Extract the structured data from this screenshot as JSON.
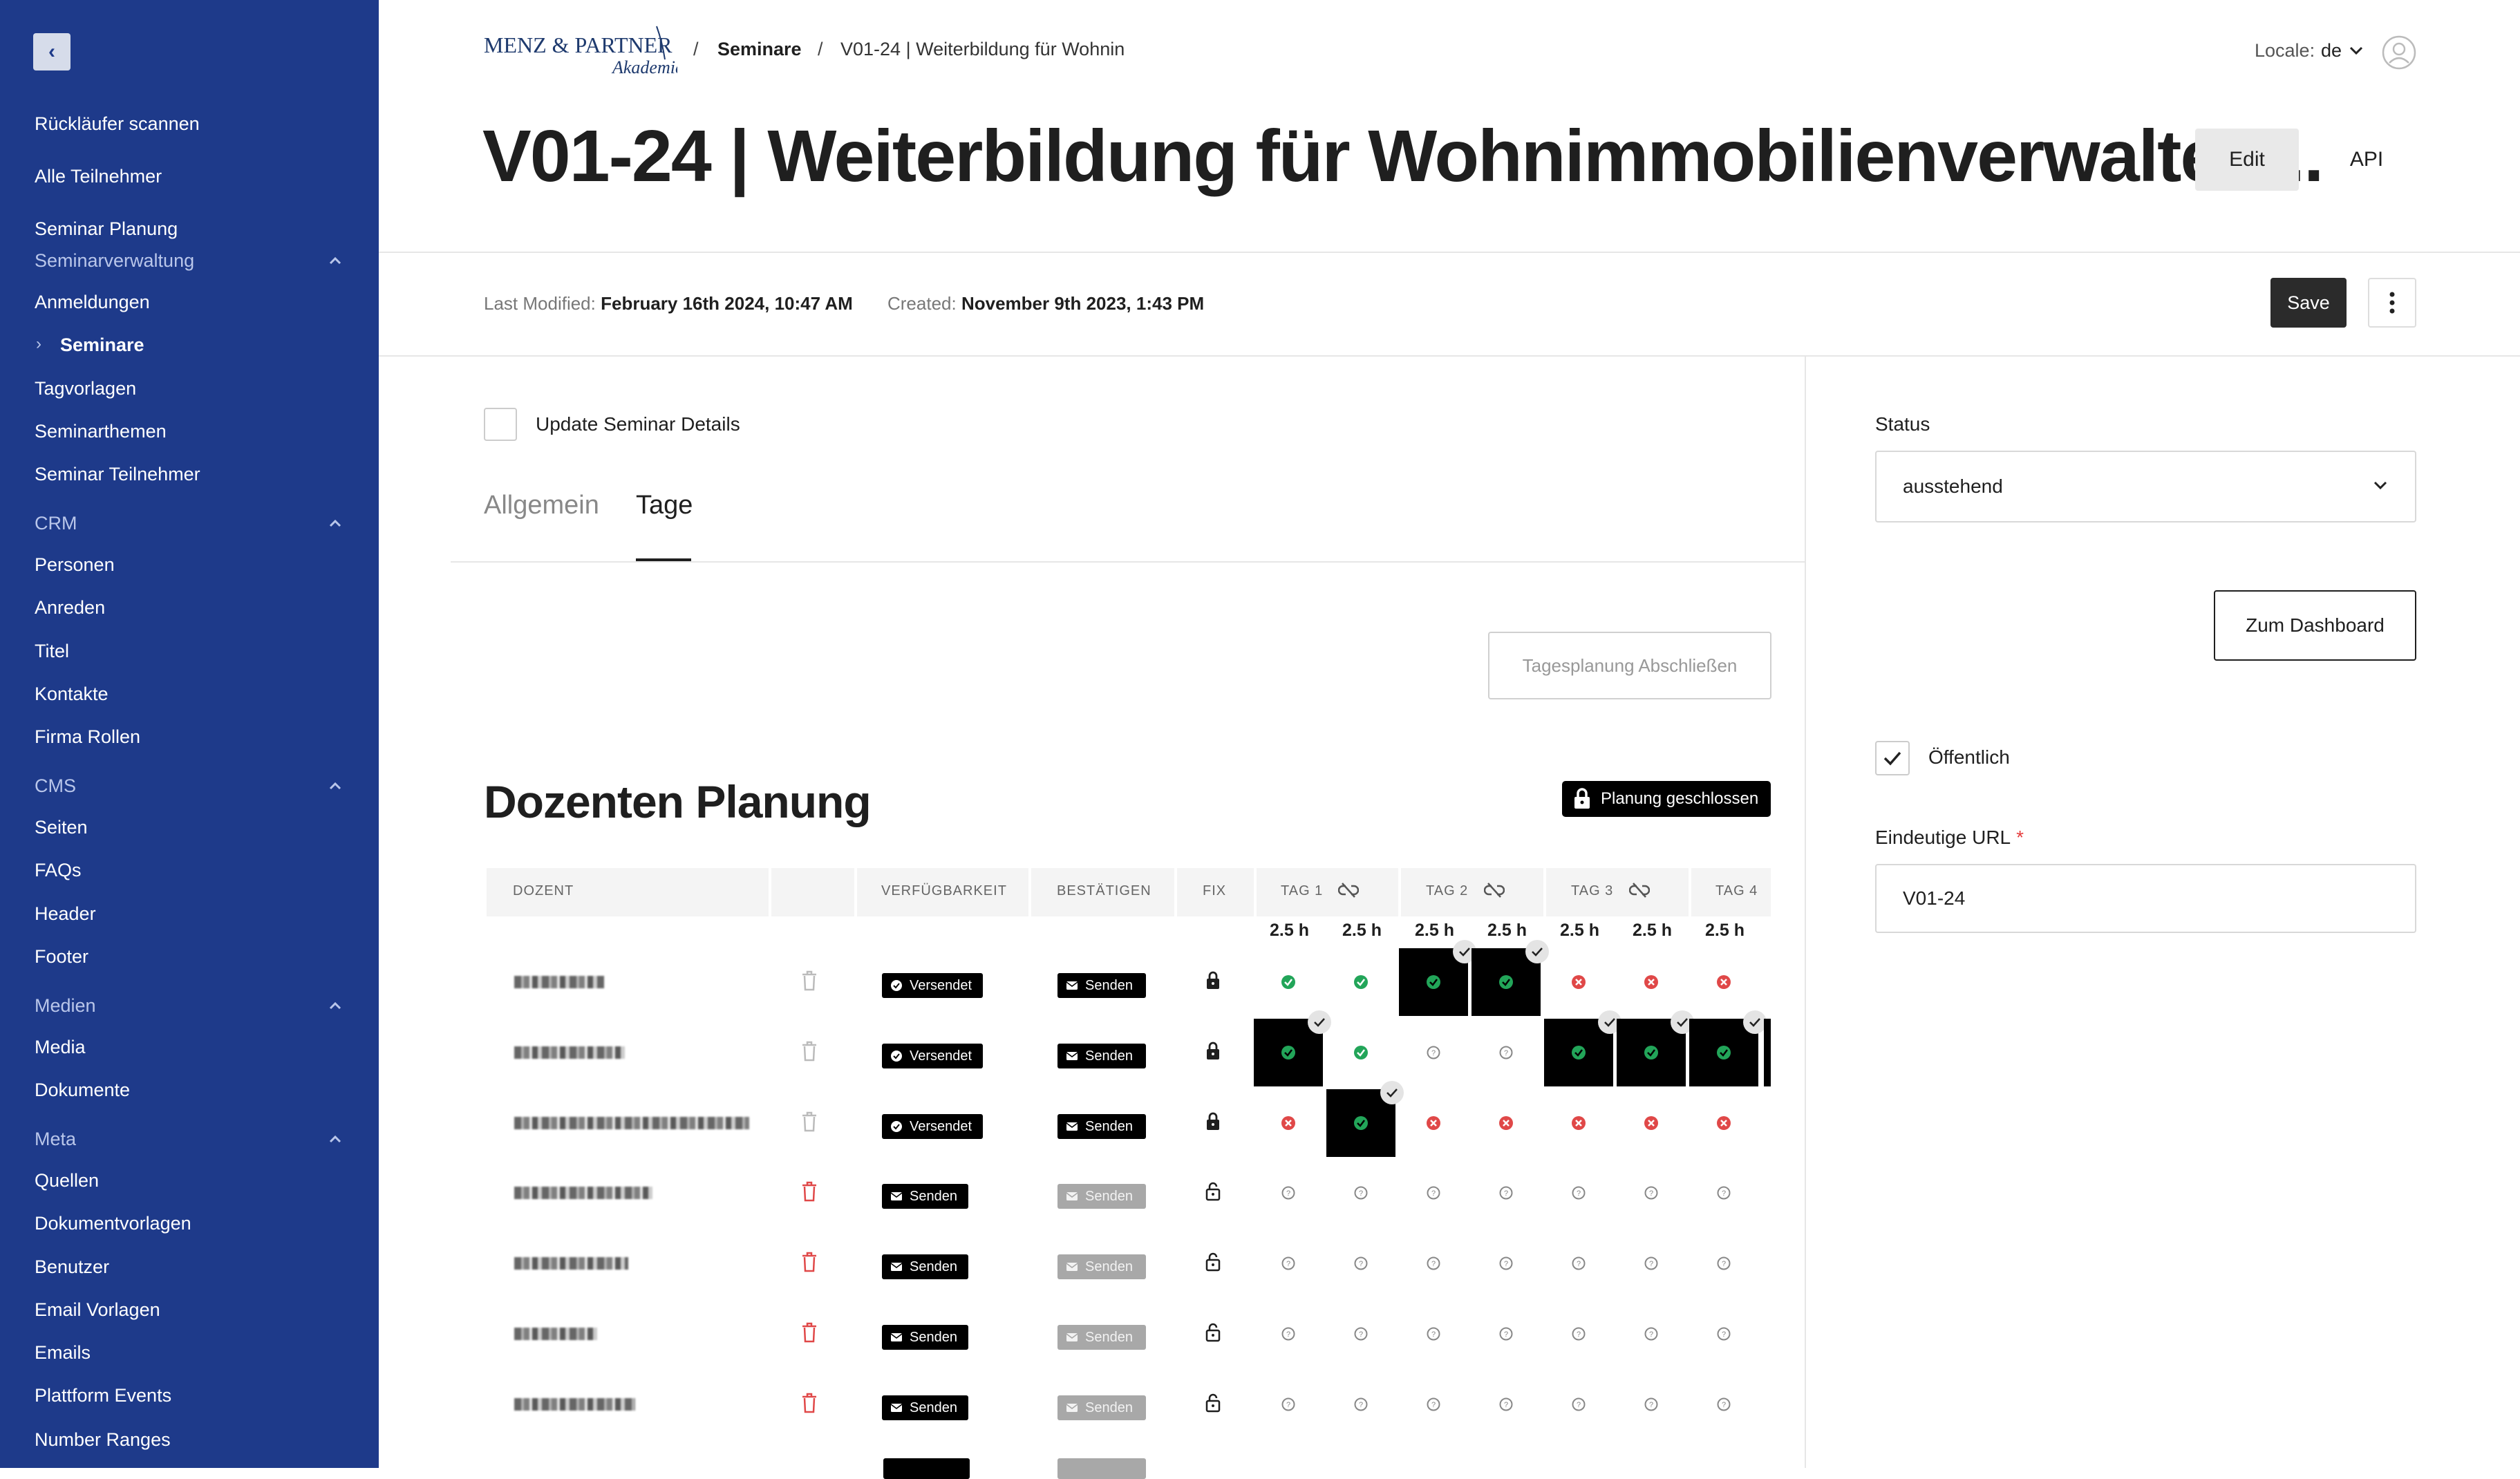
{
  "sidebar": {
    "collapse_label": "‹",
    "links_top": [
      "Rückläufer scannen",
      "Alle Teilnehmer",
      "Seminar Planung"
    ],
    "sections": [
      {
        "title": "Seminarverwaltung",
        "items": [
          "Anmeldungen",
          "Seminare",
          "Tagvorlagen",
          "Seminarthemen",
          "Seminar Teilnehmer"
        ],
        "active": "Seminare"
      },
      {
        "title": "CRM",
        "items": [
          "Personen",
          "Anreden",
          "Titel",
          "Kontakte",
          "Firma Rollen"
        ]
      },
      {
        "title": "CMS",
        "items": [
          "Seiten",
          "FAQs",
          "Header",
          "Footer"
        ]
      },
      {
        "title": "Medien",
        "items": [
          "Media",
          "Dokumente"
        ]
      },
      {
        "title": "Meta",
        "items": [
          "Quellen",
          "Dokumentvorlagen",
          "Benutzer",
          "Email Vorlagen",
          "Emails",
          "Plattform Events",
          "Number Ranges"
        ]
      }
    ]
  },
  "header": {
    "logo": {
      "line1": "MENZ & PARTNER",
      "line2": "Akademie"
    },
    "breadcrumb": [
      "Seminare",
      "V01-24 | Weiterbildung für Wohnin"
    ],
    "breadcrumb_separator": "/",
    "locale_label": "Locale:",
    "locale_value": "de"
  },
  "page": {
    "title": "V01-24 | Weiterbildung für Wohnimmobilienverwalter ...",
    "edit_label": "Edit",
    "api_label": "API",
    "last_modified_label": "Last Modified:",
    "last_modified_value": "February 16th 2024, 10:47 AM",
    "created_label": "Created:",
    "created_value": "November 9th 2023, 1:43 PM",
    "save_label": "Save"
  },
  "form": {
    "update_details_label": "Update Seminar Details",
    "tabs": [
      "Allgemein",
      "Tage"
    ],
    "active_tab": "Tage",
    "tagesplanung_label": "Tagesplanung Abschließen",
    "section_title": "Dozenten Planung",
    "planning_badge": "Planung geschlossen"
  },
  "table": {
    "columns": [
      "DOZENT",
      "VERFÜGBARKEIT",
      "BESTÄTIGEN",
      "FIX",
      "TAG 1",
      "TAG 2",
      "TAG 3",
      "TAG 4"
    ],
    "hours": [
      "2.5 h",
      "2.5 h",
      "2.5 h",
      "2.5 h",
      "2.5 h",
      "2.5 h",
      "2.5 h"
    ],
    "rows": [
      {
        "availability": "Versendet",
        "confirm": "Senden",
        "status": "sent",
        "cells": [
          "ok",
          "ok",
          "ok*",
          "ok*",
          "x",
          "x",
          "x"
        ]
      },
      {
        "availability": "Versendet",
        "confirm": "Senden",
        "status": "sent",
        "cells": [
          "ok*",
          "ok",
          "q",
          "q",
          "ok*",
          "ok*",
          "ok*"
        ]
      },
      {
        "availability": "Versendet",
        "confirm": "Senden",
        "status": "sent",
        "cells": [
          "x",
          "ok*",
          "x",
          "x",
          "x",
          "x",
          "x"
        ]
      },
      {
        "availability": "Senden",
        "confirm": "Senden",
        "status": "open",
        "cells": [
          "q",
          "q",
          "q",
          "q",
          "q",
          "q",
          "q"
        ]
      },
      {
        "availability": "Senden",
        "confirm": "Senden",
        "status": "open",
        "cells": [
          "q",
          "q",
          "q",
          "q",
          "q",
          "q",
          "q"
        ]
      },
      {
        "availability": "Senden",
        "confirm": "Senden",
        "status": "open",
        "cells": [
          "q",
          "q",
          "q",
          "q",
          "q",
          "q",
          "q"
        ]
      },
      {
        "availability": "Senden",
        "confirm": "Senden",
        "status": "open",
        "cells": [
          "q",
          "q",
          "q",
          "q",
          "q",
          "q",
          "q"
        ]
      }
    ]
  },
  "right_panel": {
    "status_label": "Status",
    "status_value": "ausstehend",
    "dashboard_label": "Zum Dashboard",
    "public_label": "Öffentlich",
    "public_checked": true,
    "url_label": "Eindeutige URL",
    "url_required_mark": "*",
    "url_value": "V01-24"
  },
  "colors": {
    "sidebar_bg": "#1e3a8a",
    "success": "#22a559",
    "danger": "#e04848",
    "primary_dark": "#1f1f1f"
  }
}
